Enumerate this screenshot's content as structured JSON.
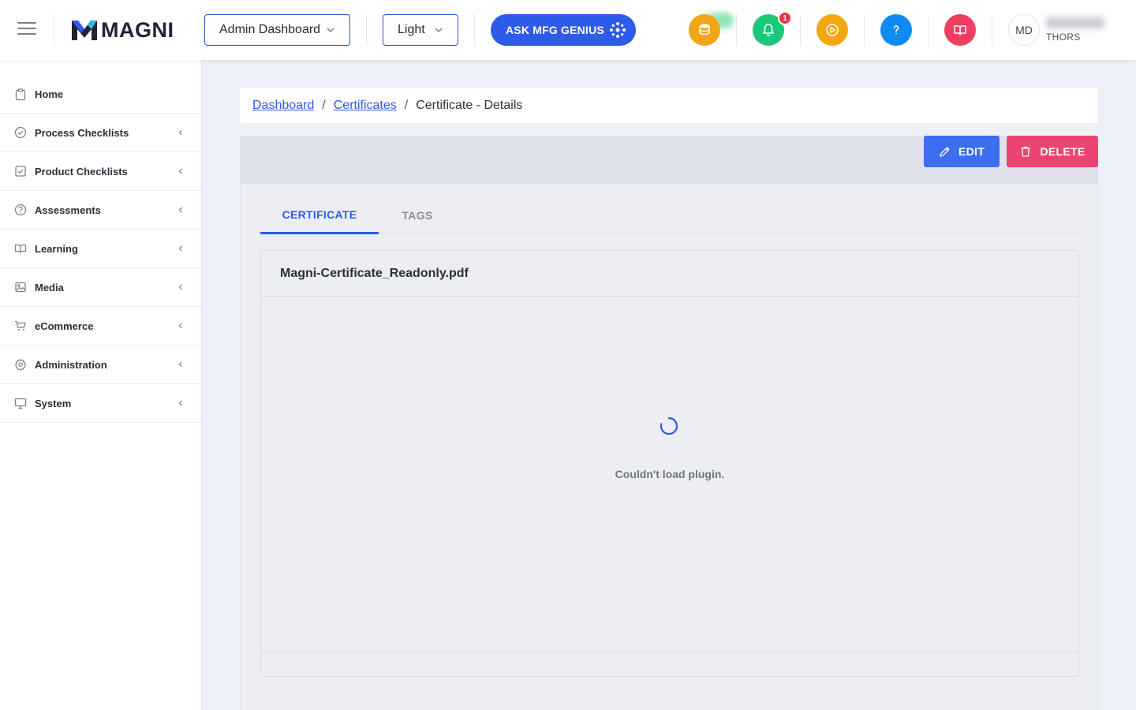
{
  "header": {
    "logo_text": "MAGNI",
    "dashboard_select": "Admin Dashboard",
    "theme_select": "Light",
    "ask_button": "ASK MFG GENIUS",
    "notification_count": "1",
    "avatar_initials": "MD",
    "user_org": "THORS",
    "colors": {
      "coins": "#f2a516",
      "bell": "#1dc77a",
      "play": "#f6a70d",
      "help": "#0d8bf2",
      "book": "#ee3f63",
      "primary": "#2f5bea"
    }
  },
  "sidebar": {
    "items": [
      {
        "label": "Home",
        "icon": "clipboard-icon",
        "expandable": false
      },
      {
        "label": "Process Checklists",
        "icon": "check-circle-icon",
        "expandable": true
      },
      {
        "label": "Product Checklists",
        "icon": "check-square-icon",
        "expandable": true
      },
      {
        "label": "Assessments",
        "icon": "question-circle-icon",
        "expandable": true
      },
      {
        "label": "Learning",
        "icon": "book-open-icon",
        "expandable": true
      },
      {
        "label": "Media",
        "icon": "image-icon",
        "expandable": true
      },
      {
        "label": "eCommerce",
        "icon": "cart-icon",
        "expandable": true
      },
      {
        "label": "Administration",
        "icon": "gear-icon",
        "expandable": true
      },
      {
        "label": "System",
        "icon": "monitor-icon",
        "expandable": true
      }
    ]
  },
  "breadcrumb": {
    "items": [
      "Dashboard",
      "Certificates",
      "Certificate - Details"
    ],
    "separator": "/"
  },
  "actions": {
    "edit_label": "EDIT",
    "delete_label": "DELETE"
  },
  "tabs": {
    "items": [
      "CERTIFICATE",
      "TAGS"
    ],
    "active": "CERTIFICATE"
  },
  "file": {
    "name": "Magni-Certificate_Readonly.pdf",
    "viewer_message": "Couldn't load plugin."
  }
}
